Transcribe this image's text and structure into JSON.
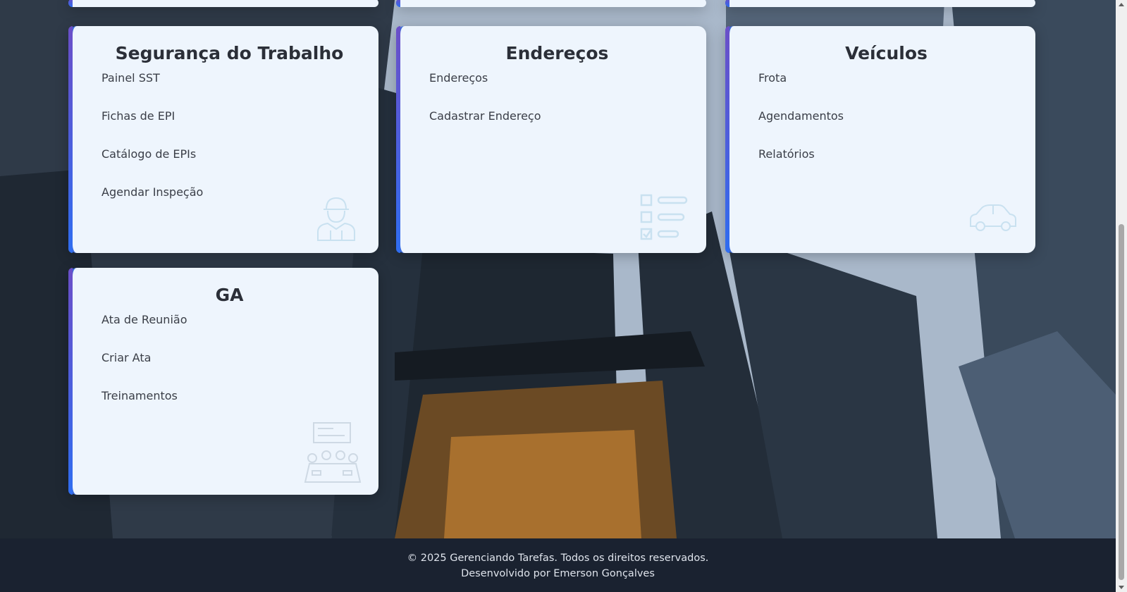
{
  "cards": [
    {
      "title": "Segurança do Trabalho",
      "items": [
        "Painel SST",
        "Fichas de EPI",
        "Catálogo de EPIs",
        "Agendar Inspeção"
      ],
      "icon": "worker-icon"
    },
    {
      "title": "Endereços",
      "items": [
        "Endereços",
        "Cadastrar Endereço"
      ],
      "icon": "checklist-icon"
    },
    {
      "title": "Veículos",
      "items": [
        "Frota",
        "Agendamentos",
        "Relatórios"
      ],
      "icon": "car-icon"
    },
    {
      "title": "GA",
      "items": [
        "Ata de Reunião",
        "Criar Ata",
        "Treinamentos"
      ],
      "icon": "meeting-icon"
    }
  ],
  "footer": {
    "copyright": "© 2025 Gerenciando Tarefas. Todos os direitos reservados.",
    "credit": "Desenvolvido por Emerson Gonçalves"
  },
  "colors": {
    "card_bg": "#eef5fd",
    "accent_start": "#6b4fc8",
    "accent_end": "#2f6df0",
    "footer_bg": "#1a2230"
  }
}
